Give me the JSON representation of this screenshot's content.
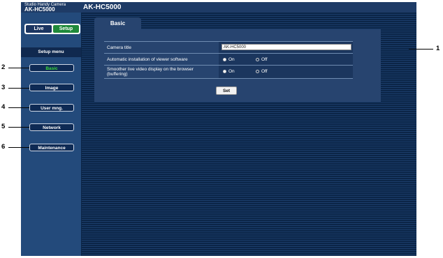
{
  "header": {
    "brand_small": "Studio Handy Camera",
    "brand_model": "AK-HC5000",
    "title": "AK-HC5000"
  },
  "sidebar": {
    "live_label": "Live",
    "setup_label": "Setup",
    "menu_title": "Setup menu",
    "items": [
      {
        "label": "Basic",
        "active": true
      },
      {
        "label": "Image",
        "active": false
      },
      {
        "label": "User mng.",
        "active": false
      },
      {
        "label": "Network",
        "active": false
      },
      {
        "label": "Maintenance",
        "active": false
      }
    ]
  },
  "main": {
    "tab_label": "Basic",
    "rows": {
      "camera_title": {
        "label": "Camera title",
        "value": "AK-HC5000"
      },
      "auto_install": {
        "label": "Automatic installation of viewer software",
        "on": "On",
        "off": "Off",
        "selected": "On"
      },
      "smoother": {
        "label_line1": "Smoother live video display on the browser",
        "label_line2": "(buffering)",
        "on": "On",
        "off": "Off",
        "selected": "On"
      }
    },
    "set_label": "Set"
  },
  "callouts": [
    "1",
    "2",
    "3",
    "4",
    "5",
    "6"
  ],
  "colors": {
    "background": "#0b2547",
    "sidebar": "#234a7b",
    "setup_active": "#1f8a3a",
    "active_text": "#3bdc3b"
  }
}
